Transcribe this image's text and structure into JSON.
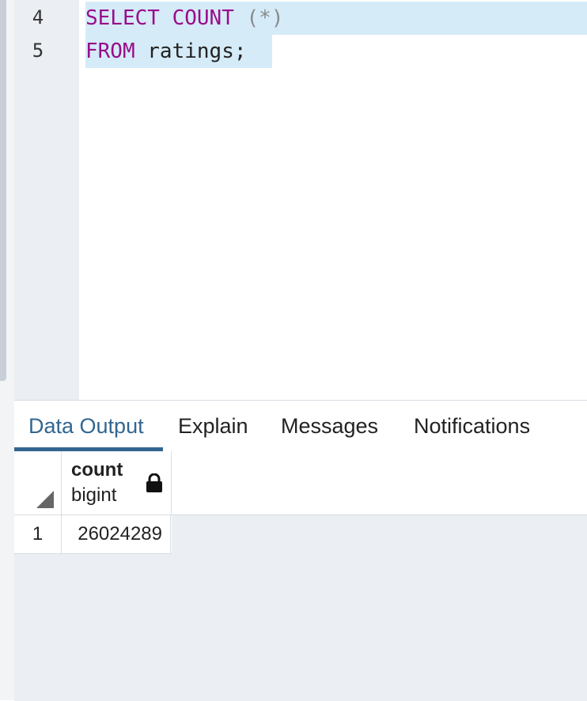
{
  "editor": {
    "lines": [
      {
        "number": "4",
        "tokens": [
          "SELECT",
          "COUNT",
          "(*)"
        ]
      },
      {
        "number": "5",
        "tokens": [
          "FROM",
          "ratings;"
        ]
      }
    ]
  },
  "results": {
    "tabs": [
      {
        "label": "Data Output",
        "active": true
      },
      {
        "label": "Explain",
        "active": false
      },
      {
        "label": "Messages",
        "active": false
      },
      {
        "label": "Notifications",
        "active": false
      }
    ],
    "columns": [
      {
        "name": "count",
        "type": "bigint",
        "icon": "lock-icon"
      }
    ],
    "rows": [
      {
        "row_number": "1",
        "values": [
          "26024289"
        ]
      }
    ]
  },
  "colors": {
    "keyword": "#990e8a",
    "selection": "#d5ebf8",
    "active_tab": "#326690"
  }
}
